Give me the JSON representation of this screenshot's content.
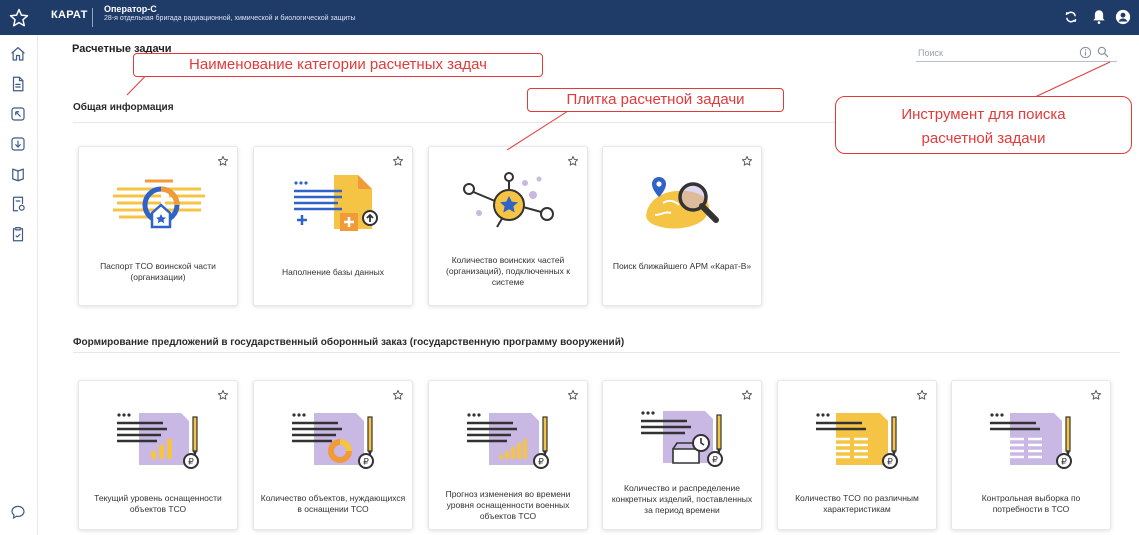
{
  "app": {
    "brand": "КАРАТ",
    "operator": "Оператор-С",
    "unit": "28-я отдельная бригада радиационной, химической и биологической защиты"
  },
  "icons": {
    "topbar": [
      "star-icon",
      "sync-icon",
      "bell-icon",
      "user-icon"
    ],
    "sidebar": [
      "home-icon",
      "document-icon",
      "arrow-back-icon",
      "download-icon",
      "book-icon",
      "doc-settings-icon",
      "clipboard-icon",
      "chat-icon"
    ]
  },
  "header": {
    "title": "Расчетные задачи",
    "search_placeholder": "Поиск"
  },
  "sections": [
    {
      "title": "Общая информация",
      "tiles": [
        {
          "label": "Паспорт ТСО воинской части (организации)",
          "icon": "passport-illustration"
        },
        {
          "label": "Наполнение базы данных",
          "icon": "database-fill-illustration"
        },
        {
          "label": "Количество воинских частей (организаций), подключенных к системе",
          "icon": "network-star-illustration"
        },
        {
          "label": "Поиск ближайшего АРМ «Карат-В»",
          "icon": "map-search-illustration"
        }
      ]
    },
    {
      "title": "Формирование предложений в государственный оборонный заказ (государственную программу вооружений)",
      "tiles": [
        {
          "label": "Текущий уровень оснащенности объектов ТСО",
          "icon": "bar-report-illustration"
        },
        {
          "label": "Количество объектов, нуждающихся в оснащении ТСО",
          "icon": "donut-report-illustration"
        },
        {
          "label": "Прогноз изменения во времени уровня оснащенности военных объектов ТСО",
          "icon": "growth-report-illustration"
        },
        {
          "label": "Количество и распределение конкретных изделий, поставленных за период времени",
          "icon": "clock-report-illustration"
        },
        {
          "label": "Количество ТСО по различным характеристикам",
          "icon": "table-report-illustration"
        },
        {
          "label": "Контрольная выборка по потребности в ТСО",
          "icon": "list-report-illustration"
        }
      ]
    }
  ],
  "annotations": {
    "category_name": "Наименование категории расчетных задач",
    "tile": "Плитка расчетной задачи",
    "search_tool": "Инструмент для поиска расчетной задачи"
  },
  "colors": {
    "topbar": "#1f3b68",
    "accent_yellow": "#f6c445",
    "accent_orange": "#f09a38",
    "accent_blue": "#2f63c7",
    "accent_purple": "#c9b7e4",
    "annotation_red": "#e23a3a"
  }
}
